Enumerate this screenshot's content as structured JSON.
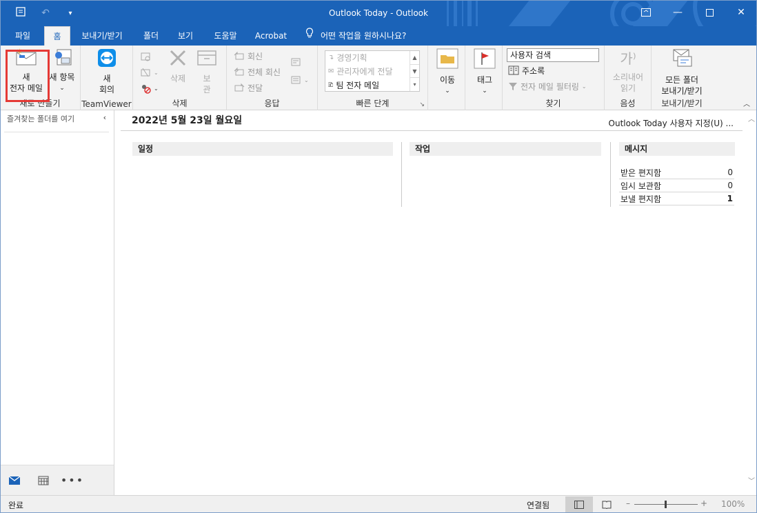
{
  "window": {
    "title": "Outlook Today  -  Outlook"
  },
  "tabs": [
    {
      "label": "파일"
    },
    {
      "label": "홈"
    },
    {
      "label": "보내기/받기"
    },
    {
      "label": "폴더"
    },
    {
      "label": "보기"
    },
    {
      "label": "도움말"
    },
    {
      "label": "Acrobat"
    }
  ],
  "tellme": "어떤 작업을 원하시나요?",
  "ribbon": {
    "new_group": {
      "new_mail_line1": "새",
      "new_mail_line2": "전자 메일",
      "new_items": "새 항목",
      "label": "새로 만들기"
    },
    "teamviewer": {
      "line1": "새",
      "line2": "회의",
      "label": "TeamViewer"
    },
    "delete_group": {
      "delete": "삭제",
      "archive_line1": "보",
      "archive_line2": "관",
      "label": "삭제"
    },
    "respond": {
      "reply": "회신",
      "reply_all": "전체 회신",
      "forward": "전달",
      "label": "응답"
    },
    "quicksteps": {
      "items": [
        "경영기획",
        "관리자에게 전달",
        "팀 전자 메일"
      ],
      "label": "빠른 단계"
    },
    "move": {
      "label_btn": "이동"
    },
    "tags": {
      "label_btn": "태그"
    },
    "find": {
      "search_people": "사용자 검색",
      "address_book": "주소록",
      "filter_email": "전자 메일 필터링",
      "label": "찾기"
    },
    "speech": {
      "read_aloud_line1": "소리내어",
      "read_aloud_line2": "읽기",
      "label": "음성"
    },
    "sendreceive": {
      "line1": "모든 폴더",
      "line2": "보내기/받기",
      "label": "보내기/받기"
    }
  },
  "nav": {
    "favorites_hint": "즐겨찾는 폴더를 여기"
  },
  "today": {
    "date": "2022년 5월 23일 월요일",
    "customize": "Outlook Today 사용자 지정(U) ...",
    "calendar_header": "일정",
    "tasks_header": "작업",
    "messages_header": "메시지",
    "messages": [
      {
        "name": "받은 편지함",
        "count": "0"
      },
      {
        "name": "임시 보관함",
        "count": "0"
      },
      {
        "name": "보낼 편지함",
        "count": "1"
      }
    ]
  },
  "status": {
    "left": "완료",
    "connection": "연결됨",
    "zoom": "100%"
  },
  "colors": {
    "brand_blue": "#1b63b8",
    "highlight_red": "#e53935"
  }
}
